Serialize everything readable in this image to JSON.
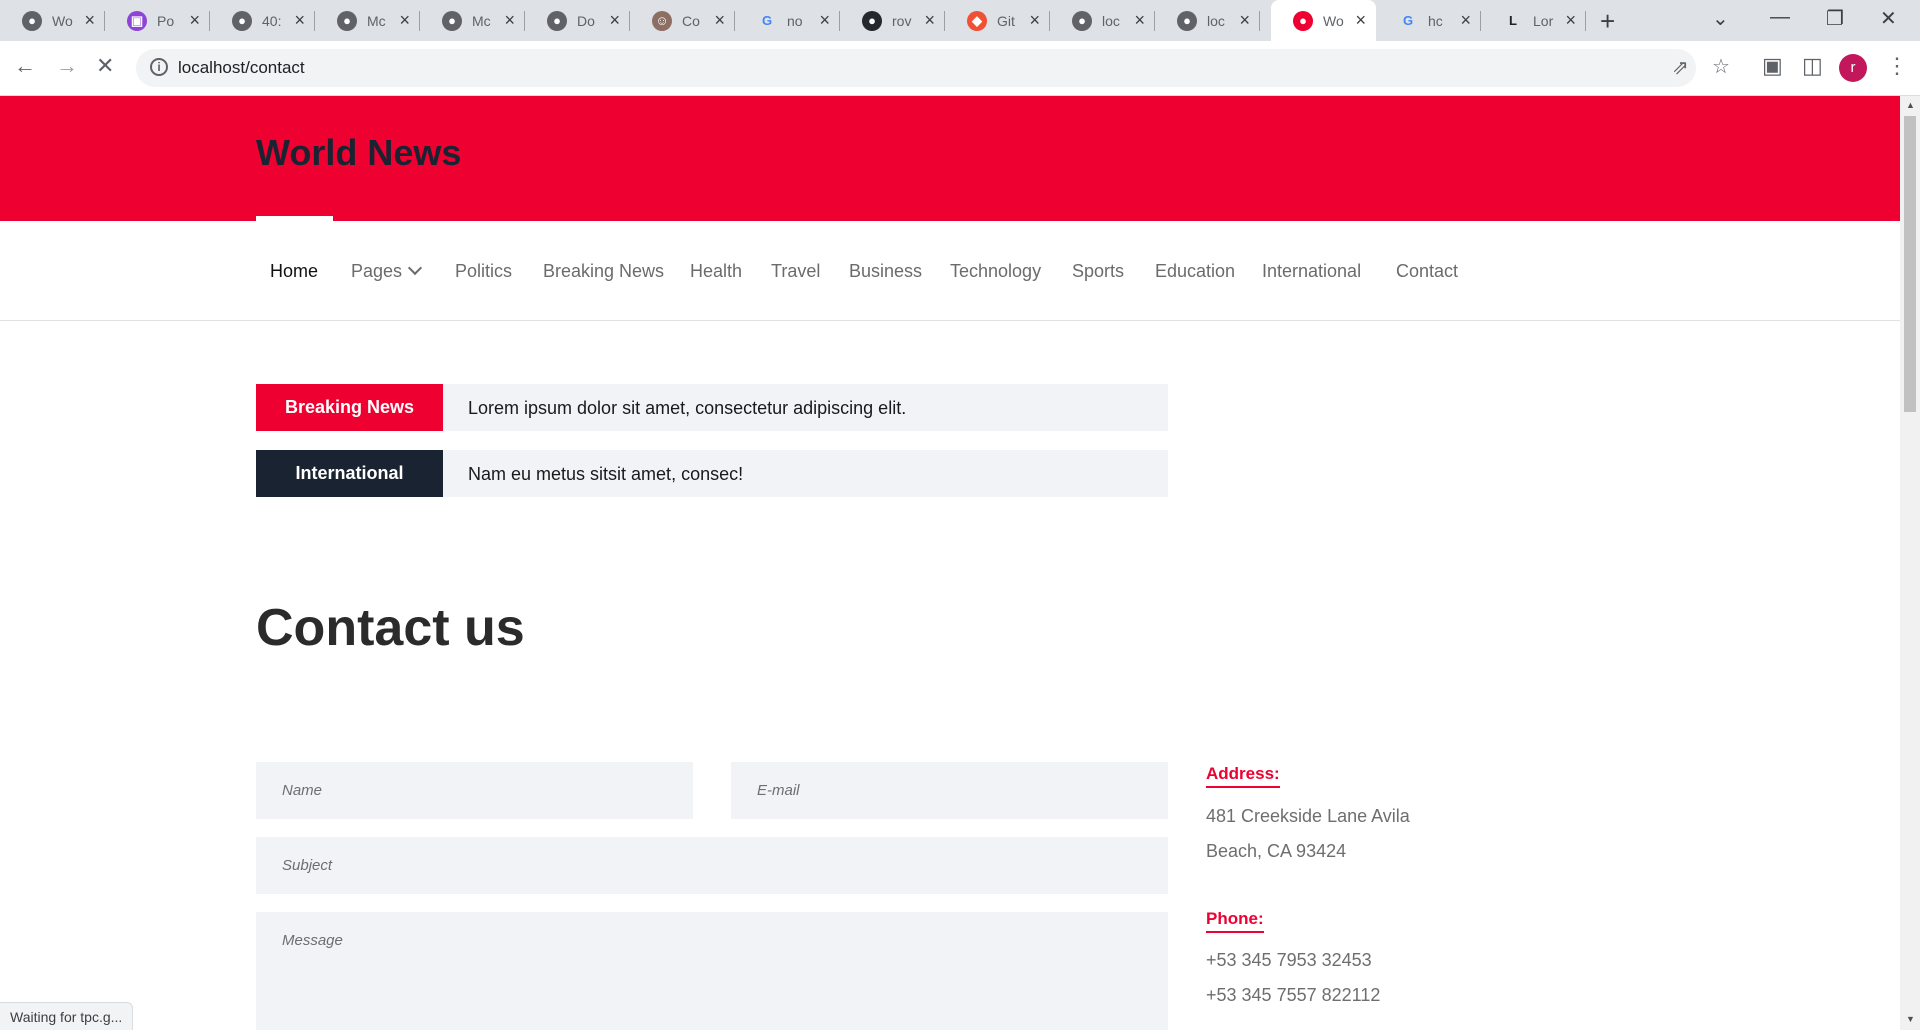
{
  "browser": {
    "tabs": [
      {
        "title": "Wo",
        "icon": "globe-icon",
        "color": "#5f6368"
      },
      {
        "title": "Po",
        "icon": "app-icon",
        "color": "#8e44d4"
      },
      {
        "title": "40:",
        "icon": "globe-icon",
        "color": "#5f6368"
      },
      {
        "title": "Mc",
        "icon": "globe-icon",
        "color": "#5f6368"
      },
      {
        "title": "Mc",
        "icon": "globe-icon",
        "color": "#5f6368"
      },
      {
        "title": "Do",
        "icon": "globe-icon",
        "color": "#5f6368"
      },
      {
        "title": "Co",
        "icon": "avatar-icon",
        "color": "#8d6e63"
      },
      {
        "title": "no",
        "icon": "google-icon",
        "color": "#4285f4"
      },
      {
        "title": "rov",
        "icon": "github-icon",
        "color": "#24292e"
      },
      {
        "title": "Git",
        "icon": "git-icon",
        "color": "#f05033"
      },
      {
        "title": "loc",
        "icon": "globe-icon",
        "color": "#5f6368"
      },
      {
        "title": "loc",
        "icon": "globe-icon",
        "color": "#5f6368"
      },
      {
        "title": "Wo",
        "icon": "recording-icon",
        "color": "#ee0030",
        "active": true
      },
      {
        "title": "hc",
        "icon": "google-icon",
        "color": "#4285f4"
      },
      {
        "title": "Lor",
        "icon": "l-icon",
        "color": "#202124"
      }
    ],
    "url": "localhost/contact",
    "profile_initial": "r",
    "status_text": "Waiting for tpc.g..."
  },
  "site": {
    "title": "World News",
    "nav": [
      {
        "label": "Home",
        "active": true
      },
      {
        "label": "Pages",
        "dropdown": true
      },
      {
        "label": "Politics"
      },
      {
        "label": "Breaking News"
      },
      {
        "label": "Health"
      },
      {
        "label": "Travel"
      },
      {
        "label": "Business"
      },
      {
        "label": "Technology"
      },
      {
        "label": "Sports"
      },
      {
        "label": "Education"
      },
      {
        "label": "International"
      },
      {
        "label": "Contact"
      }
    ],
    "tickers": [
      {
        "label": "Breaking News",
        "text": "Lorem ipsum dolor sit amet, consectetur adipiscing elit.",
        "color": "#ee0030"
      },
      {
        "label": "International",
        "text": "Nam eu metus sitsit amet, consec!",
        "color": "#1a2332"
      }
    ]
  },
  "contact": {
    "heading": "Contact us",
    "form": {
      "name_placeholder": "Name",
      "email_placeholder": "E-mail",
      "subject_placeholder": "Subject",
      "message_placeholder": "Message"
    },
    "address_label": "Address:",
    "address_lines": [
      "481 Creekside Lane Avila",
      "Beach, CA 93424"
    ],
    "phone_label": "Phone:",
    "phone_lines": [
      "+53 345 7953 32453",
      "+53 345 7557 822112"
    ]
  },
  "colors": {
    "accent": "#ee0030",
    "dark": "#1a2332",
    "field_bg": "#f2f3f7"
  }
}
